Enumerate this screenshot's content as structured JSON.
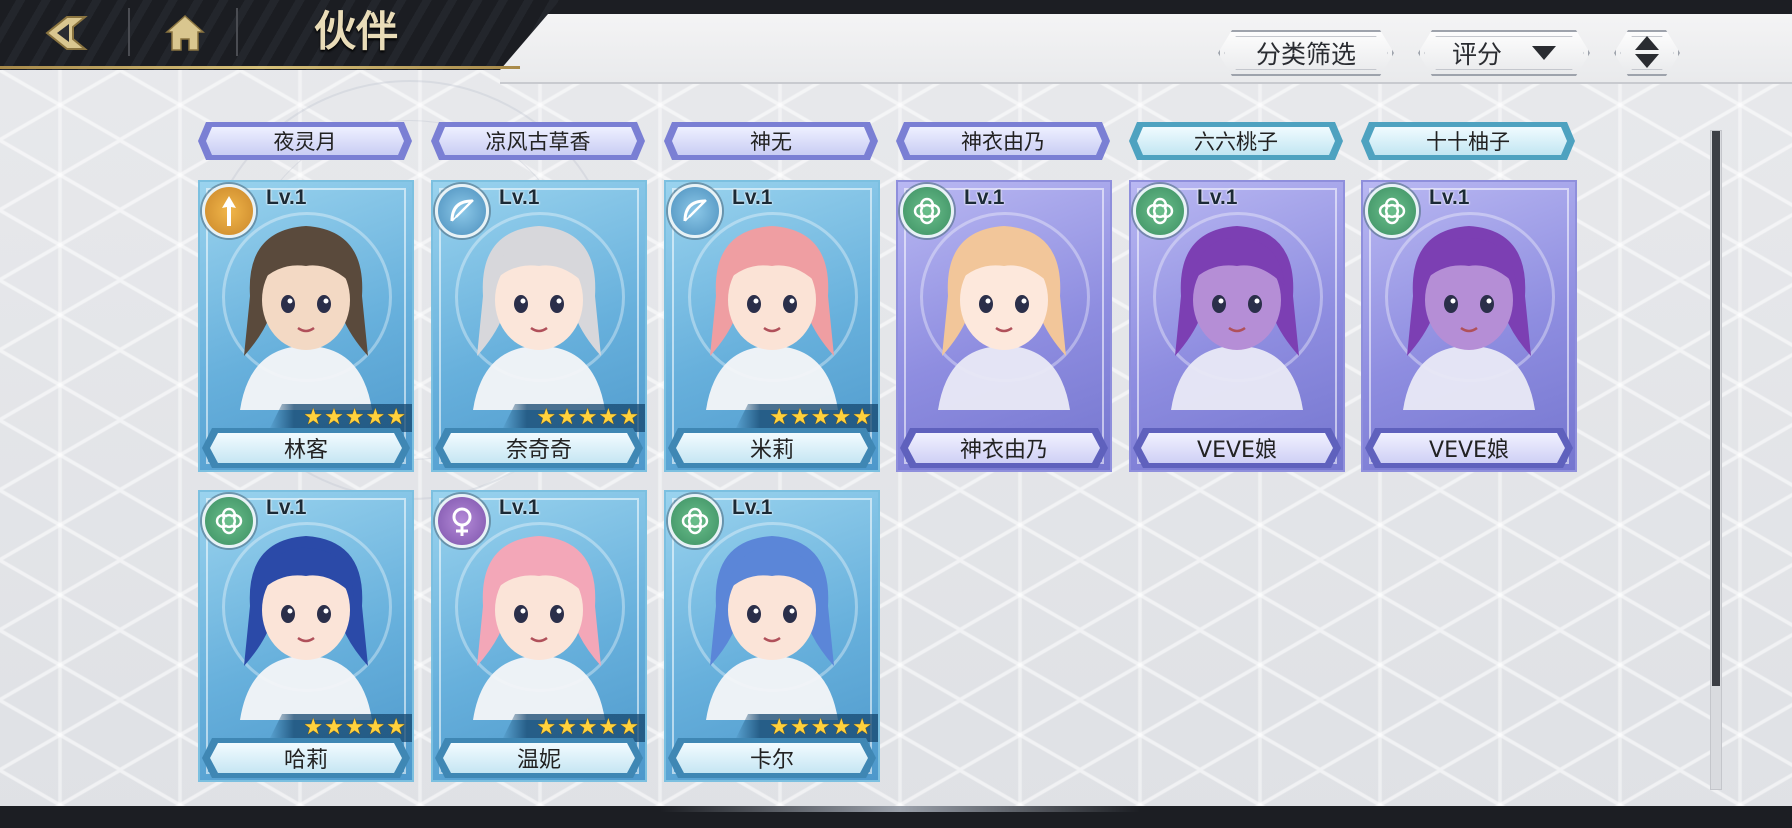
{
  "header": {
    "title": "伙伴",
    "filter_label": "分类筛选",
    "sort_label": "评分",
    "back_icon": "back-arrow-icon",
    "home_icon": "home-icon",
    "order_icon": "sort-order-icon"
  },
  "top_names": [
    "夜灵月",
    "凉风古草香",
    "神无",
    "神衣由乃",
    "六六桃子",
    "十十柚子"
  ],
  "top_name_styles": [
    "purple",
    "purple",
    "purple",
    "purple",
    "blue",
    "blue"
  ],
  "cards": [
    {
      "name": "林客",
      "level": "Lv.1",
      "stars": 5,
      "frame": "blue",
      "class_icon": "arrow-class-icon",
      "badge": "gold",
      "hair": "#5a4a3c",
      "skin": "#f3d9c4"
    },
    {
      "name": "奈奇奇",
      "level": "Lv.1",
      "stars": 5,
      "frame": "blue",
      "class_icon": "bow-class-icon",
      "badge": "blue",
      "hair": "#d7d7db",
      "skin": "#fbe6da"
    },
    {
      "name": "米莉",
      "level": "Lv.1",
      "stars": 5,
      "frame": "blue",
      "class_icon": "bow-class-icon",
      "badge": "blue",
      "hair": "#ef9ea2",
      "skin": "#fbe3d6"
    },
    {
      "name": "神衣由乃",
      "level": "Lv.1",
      "stars": 0,
      "frame": "purple",
      "class_icon": "clover-class-icon",
      "badge": "green",
      "hair": "#f2c69a",
      "skin": "#fde8dc"
    },
    {
      "name": "VEVE娘",
      "level": "Lv.1",
      "stars": 0,
      "frame": "purple",
      "class_icon": "clover-class-icon",
      "badge": "green",
      "hair": "#7c3fb3",
      "skin": "#b58ed6"
    },
    {
      "name": "VEVE娘",
      "level": "Lv.1",
      "stars": 0,
      "frame": "purple",
      "class_icon": "clover-class-icon",
      "badge": "green",
      "hair": "#7c3fb3",
      "skin": "#b58ed6"
    },
    {
      "name": "哈莉",
      "level": "Lv.1",
      "stars": 5,
      "frame": "blue",
      "class_icon": "clover-class-icon",
      "badge": "green",
      "hair": "#2b4aa8",
      "skin": "#fbe4d8"
    },
    {
      "name": "温妮",
      "level": "Lv.1",
      "stars": 5,
      "frame": "blue",
      "class_icon": "ring-class-icon",
      "badge": "purple",
      "hair": "#f3a7b8",
      "skin": "#fbe4d8"
    },
    {
      "name": "卡尔",
      "level": "Lv.1",
      "stars": 5,
      "frame": "blue",
      "class_icon": "clover-class-icon",
      "badge": "green",
      "hair": "#5b86d8",
      "skin": "#fbe4d8"
    }
  ]
}
